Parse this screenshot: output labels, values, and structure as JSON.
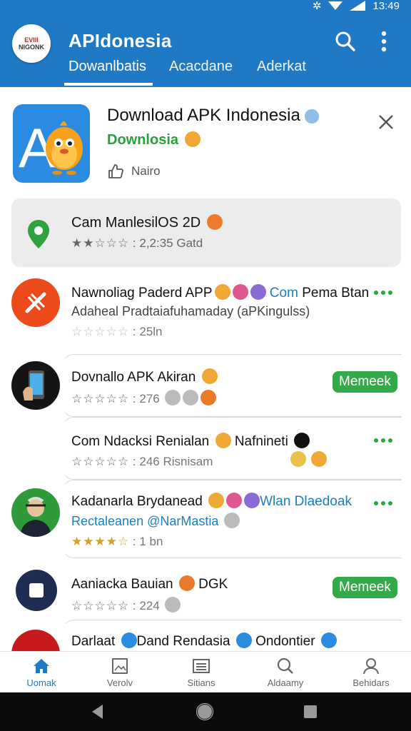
{
  "status": {
    "time": "13:49"
  },
  "app": {
    "title": "APIdonesia",
    "logo_top": "EVIII",
    "logo_bottom": "NIGONK",
    "tabs": [
      {
        "label": "Dowanlbatis",
        "active": true
      },
      {
        "label": "Acacdane",
        "active": false
      },
      {
        "label": "Aderkat",
        "active": false
      }
    ],
    "accent": "#1f79c4"
  },
  "feature": {
    "title": "Download APK Indonesia",
    "subtitle": "Downlosia",
    "like_label": "Nairo",
    "icon": "a-letter-chick-icon"
  },
  "highlight": {
    "name": "Cam ManlesilOS 2D",
    "rating": "2,2:35",
    "extra": "Gatd",
    "icon": "map-pin-icon"
  },
  "list": [
    {
      "name": "Nawnoliag Paderd APP",
      "name_link": "Com",
      "name_tail": "Pema Btan",
      "sub": "Adaheal Pradtaiafuhamaday (aPKingulss)",
      "rating": "25ln",
      "action": "more",
      "icon": "tool-slash-icon"
    },
    {
      "name": "Dovnallo APK Akiran",
      "rating": "276",
      "action_label": "Memeek",
      "icon": "phone-hand-icon"
    },
    {
      "name": "Com Ndacksi Renialan",
      "name_tail": "Nafnineti",
      "rating": "246",
      "extra": "Risnisam",
      "action": "more"
    },
    {
      "name": "Kadanarla Brydanead",
      "name_link": "Wlan Dlaedoak",
      "sub": "Rectaleanen @NarMastia",
      "rating": "1 bn",
      "action": "more",
      "icon": "person-avatar-icon"
    },
    {
      "name": "Aaniacka Bauian",
      "name_tail": "DGK",
      "rating": "224",
      "action_label": "Memeek",
      "icon": "stop-square-icon"
    },
    {
      "name": "Darlaat",
      "name_tail": "Dand Rendasia",
      "name_end": "Ondontier",
      "icon": "red-circle-icon"
    }
  ],
  "bottom_nav": [
    {
      "label": "Uomak",
      "icon": "home-icon",
      "active": true
    },
    {
      "label": "Verolv",
      "icon": "image-grid-icon",
      "active": false
    },
    {
      "label": "Sitians",
      "icon": "list-icon",
      "active": false
    },
    {
      "label": "Aldaamy",
      "icon": "search-icon",
      "active": false
    },
    {
      "label": "Behidars",
      "icon": "profile-icon",
      "active": false
    }
  ]
}
